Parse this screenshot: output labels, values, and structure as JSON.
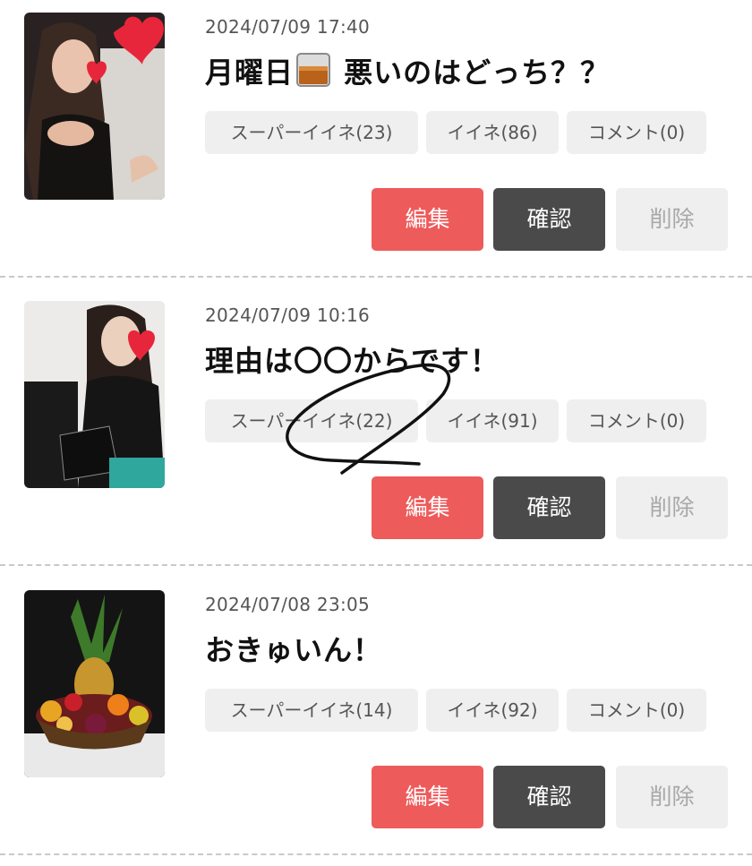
{
  "posts": [
    {
      "date": "2024/07/09 17:40",
      "title_before": "月曜日",
      "title_after": " 悪いのはどっち？？",
      "super_like": "スーパーイイネ(23)",
      "like": "イイネ(86)",
      "comment": "コメント(0)",
      "edit": "編集",
      "confirm": "確認",
      "delete": "削除"
    },
    {
      "date": "2024/07/09 10:16",
      "title": "理由は〇〇からです！",
      "super_like": "スーパーイイネ(22)",
      "like": "イイネ(91)",
      "comment": "コメント(0)",
      "edit": "編集",
      "confirm": "確認",
      "delete": "削除"
    },
    {
      "date": "2024/07/08 23:05",
      "title": "おきゅいん！",
      "super_like": "スーパーイイネ(14)",
      "like": "イイネ(92)",
      "comment": "コメント(0)",
      "edit": "編集",
      "confirm": "確認",
      "delete": "削除"
    }
  ],
  "colors": {
    "edit_button": "#ee5b5b",
    "confirm_button": "#4a4a4a",
    "delete_button": "#efefef",
    "tag_background": "#efefef"
  },
  "icons": [
    "whiskey-glass-icon",
    "heart-sticker-icon"
  ]
}
